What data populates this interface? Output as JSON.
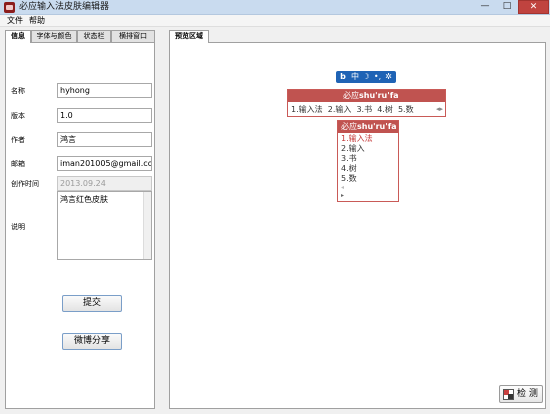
{
  "window": {
    "title": "必应输入法皮肤编辑器",
    "controls": {
      "minimize": "—",
      "maximize": "□",
      "close": "✕"
    }
  },
  "menu": {
    "items": [
      "文件",
      "帮助"
    ]
  },
  "left_tabs": [
    "信息",
    "字体与颜色",
    "状态栏",
    "横排窗口"
  ],
  "right_tabs": [
    "预览区域"
  ],
  "form": {
    "name_label": "名称",
    "name_value": "hyhong",
    "version_label": "版本",
    "version_value": "1.0",
    "author_label": "作者",
    "author_value": "鸿言",
    "email_label": "邮箱",
    "email_value": "iman201005@gmail.com",
    "created_label": "创作时间",
    "created_value": "2013.09.24",
    "desc_label": "说明",
    "desc_value": "鸿言红色皮肤"
  },
  "buttons": {
    "submit": "提交",
    "weibo_share": "微博分享",
    "check": "检 测"
  },
  "preview": {
    "status_bar": {
      "logo": "b",
      "lang": "中",
      "moon": "☽",
      "punct": "•,",
      "gear": "✲",
      "color": "#1f63b5"
    },
    "horizontal": {
      "composition_prefix": "必应",
      "composition_pinyin": "shu'ru'fa",
      "candidates": [
        "1.输入法",
        "2.输入",
        "3.书",
        "4.树",
        "5.数"
      ],
      "arrows": "◂▸"
    },
    "vertical": {
      "composition_prefix": "必应",
      "composition_pinyin": "shu'ru'fa",
      "candidates": [
        "1.输入法",
        "2.输入",
        "3.书",
        "4.树",
        "5.数"
      ],
      "arrow_up": "◂",
      "arrow_down": "▸"
    },
    "accent_color": "#c05350"
  }
}
